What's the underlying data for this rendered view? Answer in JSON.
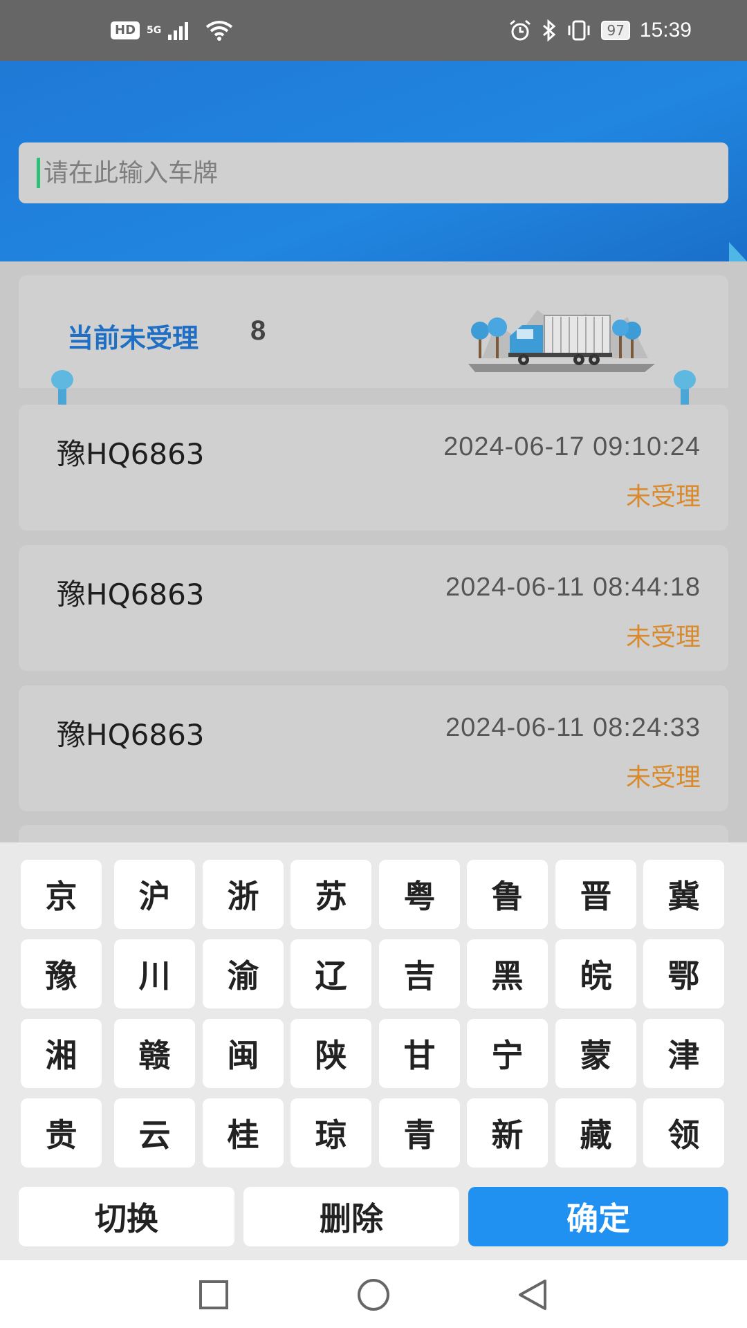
{
  "status_bar": {
    "hd": "HD",
    "network": "5G",
    "battery": "97",
    "time": "15:39"
  },
  "search": {
    "placeholder": "请在此输入车牌",
    "value": ""
  },
  "summary": {
    "label": "当前未受理",
    "count": "8"
  },
  "records": [
    {
      "plate": "豫HQ6863",
      "time": "2024-06-17 09:10:24",
      "status": "未受理"
    },
    {
      "plate": "豫HQ6863",
      "time": "2024-06-11 08:44:18",
      "status": "未受理"
    },
    {
      "plate": "豫HQ6863",
      "time": "2024-06-11 08:24:33",
      "status": "未受理"
    }
  ],
  "keyboard": {
    "rows": [
      [
        "京",
        "沪",
        "浙",
        "苏",
        "粤",
        "鲁",
        "晋",
        "冀"
      ],
      [
        "豫",
        "川",
        "渝",
        "辽",
        "吉",
        "黑",
        "皖",
        "鄂"
      ],
      [
        "湘",
        "赣",
        "闽",
        "陕",
        "甘",
        "宁",
        "蒙",
        "津"
      ],
      [
        "贵",
        "云",
        "桂",
        "琼",
        "青",
        "新",
        "藏",
        "领"
      ]
    ],
    "switch_label": "切换",
    "delete_label": "删除",
    "confirm_label": "确定"
  },
  "colors": {
    "header_blue": "#2186e0",
    "summary_blue": "#1f6fc4",
    "status_orange": "#d98a2c",
    "confirm_blue": "#2091f0"
  },
  "nav_icons": [
    "recents-square-icon",
    "home-circle-icon",
    "back-triangle-icon"
  ]
}
